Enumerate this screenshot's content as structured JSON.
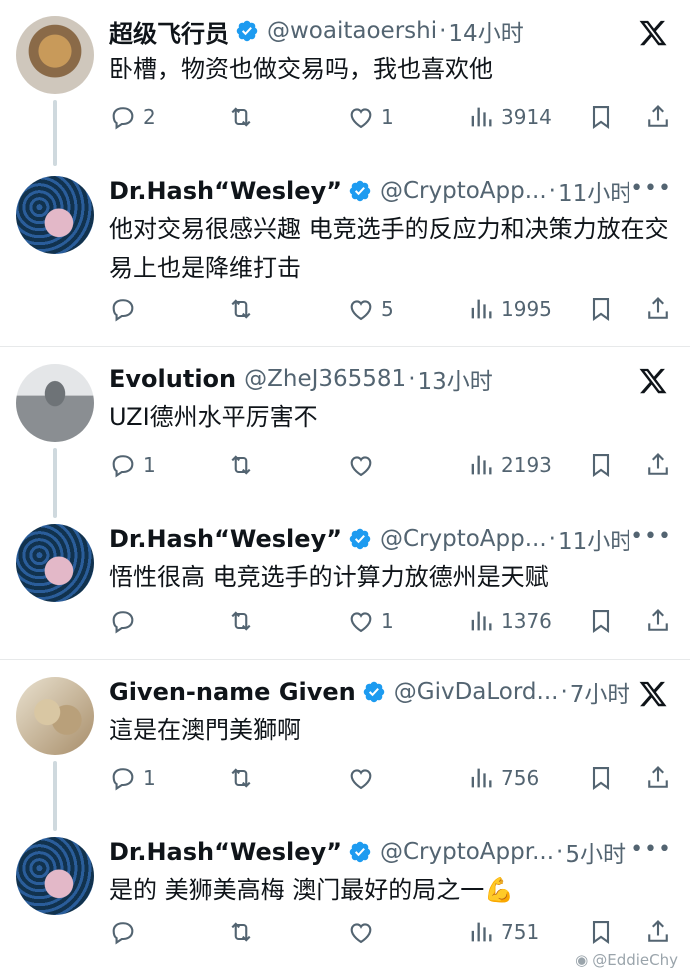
{
  "threads": [
    {
      "tweets": [
        {
          "name": "超级飞行员",
          "handle": "@woaitaoershi",
          "dot": "·",
          "time": "14小时",
          "body": "卧槽，物资也做交易吗，我也喜欢他",
          "reply": "2",
          "retweet": "",
          "like": "1",
          "views": "3914",
          "corner": "x-logo-icon"
        },
        {
          "name": "Dr.Hash“Wesley”",
          "handle": "@CryptoApp...",
          "dot": "·",
          "time": "11小时",
          "body": "他对交易很感兴趣 电竞选手的反应力和决策力放在交易上也是降维打击",
          "reply": "",
          "retweet": "",
          "like": "5",
          "views": "1995",
          "corner": "more-icon"
        }
      ]
    },
    {
      "tweets": [
        {
          "name": "Evolution",
          "handle": "@ZheJ365581",
          "dot": "·",
          "time": "13小时",
          "body": "UZI德州水平厉害不",
          "reply": "1",
          "retweet": "",
          "like": "",
          "views": "2193",
          "corner": "x-logo-icon"
        },
        {
          "name": "Dr.Hash“Wesley”",
          "handle": "@CryptoApp...",
          "dot": "·",
          "time": "11小时",
          "body": "悟性很高 电竞选手的计算力放德州是天赋",
          "reply": "",
          "retweet": "",
          "like": "1",
          "views": "1376",
          "corner": "more-icon"
        }
      ]
    },
    {
      "tweets": [
        {
          "name": "Given-name Given",
          "handle": "@GivDaLord...",
          "dot": "·",
          "time": "7小时",
          "body": "這是在澳門美獅啊",
          "reply": "1",
          "retweet": "",
          "like": "",
          "views": "756",
          "corner": "x-logo-icon"
        },
        {
          "name": "Dr.Hash“Wesley”",
          "handle": "@CryptoAppr...",
          "dot": "·",
          "time": "5小时",
          "body": "是的 美狮美高梅 澳门最好的局之一💪",
          "reply": "",
          "retweet": "",
          "like": "",
          "views": "751",
          "corner": "more-icon"
        }
      ]
    }
  ],
  "watermark": "@EddieChy",
  "colors": {
    "verified": "#1d9bf0",
    "text": "#0f1419",
    "secondary": "#536471",
    "divider": "#e7e9ea",
    "connector": "#cfd9de"
  }
}
